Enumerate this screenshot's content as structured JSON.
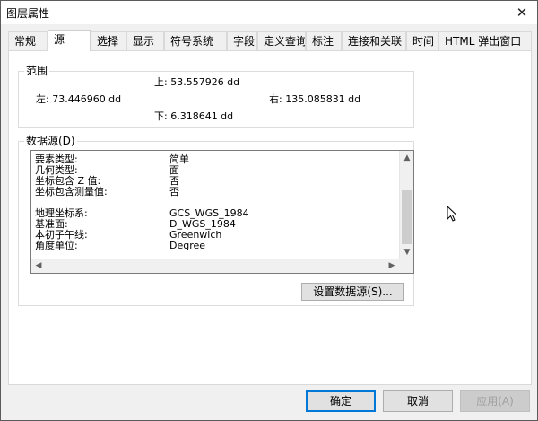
{
  "window": {
    "title": "图层属性"
  },
  "tabs": [
    {
      "label": "常规"
    },
    {
      "label": "源"
    },
    {
      "label": "选择"
    },
    {
      "label": "显示"
    },
    {
      "label": "符号系统"
    },
    {
      "label": "字段"
    },
    {
      "label": "定义查询"
    },
    {
      "label": "标注"
    },
    {
      "label": "连接和关联"
    },
    {
      "label": "时间"
    },
    {
      "label": "HTML 弹出窗口"
    }
  ],
  "extent": {
    "title": "范围",
    "top": "上:  53.557926 dd",
    "left": "左:  73.446960 dd",
    "right": "右:  135.085831 dd",
    "bottom": "下:  6.318641 dd"
  },
  "datasource": {
    "title": "数据源(D)",
    "rows": [
      {
        "key": "要素类型:",
        "value": "简单"
      },
      {
        "key": "几何类型:",
        "value": "面"
      },
      {
        "key": "坐标包含 Z 值:",
        "value": "否"
      },
      {
        "key": "坐标包含测量值:",
        "value": "否"
      },
      {
        "key": "",
        "value": ""
      },
      {
        "key": "地理坐标系:",
        "value": "GCS_WGS_1984"
      },
      {
        "key": "基准面:",
        "value": "D_WGS_1984"
      },
      {
        "key": "本初子午线:",
        "value": "Greenwich"
      },
      {
        "key": "角度单位:",
        "value": "Degree"
      }
    ],
    "set_button": "设置数据源(S)..."
  },
  "footer": {
    "ok": "确定",
    "cancel": "取消",
    "apply": "应用(A)"
  }
}
